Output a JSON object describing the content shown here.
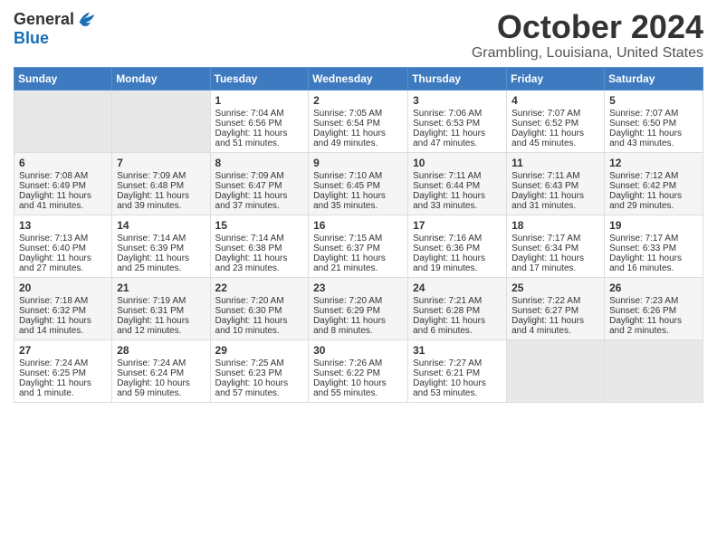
{
  "header": {
    "logo_general": "General",
    "logo_blue": "Blue",
    "month_title": "October 2024",
    "location": "Grambling, Louisiana, United States"
  },
  "days_of_week": [
    "Sunday",
    "Monday",
    "Tuesday",
    "Wednesday",
    "Thursday",
    "Friday",
    "Saturday"
  ],
  "weeks": [
    [
      {
        "day": "",
        "info": ""
      },
      {
        "day": "",
        "info": ""
      },
      {
        "day": "1",
        "info": "Sunrise: 7:04 AM\nSunset: 6:56 PM\nDaylight: 11 hours and 51 minutes."
      },
      {
        "day": "2",
        "info": "Sunrise: 7:05 AM\nSunset: 6:54 PM\nDaylight: 11 hours and 49 minutes."
      },
      {
        "day": "3",
        "info": "Sunrise: 7:06 AM\nSunset: 6:53 PM\nDaylight: 11 hours and 47 minutes."
      },
      {
        "day": "4",
        "info": "Sunrise: 7:07 AM\nSunset: 6:52 PM\nDaylight: 11 hours and 45 minutes."
      },
      {
        "day": "5",
        "info": "Sunrise: 7:07 AM\nSunset: 6:50 PM\nDaylight: 11 hours and 43 minutes."
      }
    ],
    [
      {
        "day": "6",
        "info": "Sunrise: 7:08 AM\nSunset: 6:49 PM\nDaylight: 11 hours and 41 minutes."
      },
      {
        "day": "7",
        "info": "Sunrise: 7:09 AM\nSunset: 6:48 PM\nDaylight: 11 hours and 39 minutes."
      },
      {
        "day": "8",
        "info": "Sunrise: 7:09 AM\nSunset: 6:47 PM\nDaylight: 11 hours and 37 minutes."
      },
      {
        "day": "9",
        "info": "Sunrise: 7:10 AM\nSunset: 6:45 PM\nDaylight: 11 hours and 35 minutes."
      },
      {
        "day": "10",
        "info": "Sunrise: 7:11 AM\nSunset: 6:44 PM\nDaylight: 11 hours and 33 minutes."
      },
      {
        "day": "11",
        "info": "Sunrise: 7:11 AM\nSunset: 6:43 PM\nDaylight: 11 hours and 31 minutes."
      },
      {
        "day": "12",
        "info": "Sunrise: 7:12 AM\nSunset: 6:42 PM\nDaylight: 11 hours and 29 minutes."
      }
    ],
    [
      {
        "day": "13",
        "info": "Sunrise: 7:13 AM\nSunset: 6:40 PM\nDaylight: 11 hours and 27 minutes."
      },
      {
        "day": "14",
        "info": "Sunrise: 7:14 AM\nSunset: 6:39 PM\nDaylight: 11 hours and 25 minutes."
      },
      {
        "day": "15",
        "info": "Sunrise: 7:14 AM\nSunset: 6:38 PM\nDaylight: 11 hours and 23 minutes."
      },
      {
        "day": "16",
        "info": "Sunrise: 7:15 AM\nSunset: 6:37 PM\nDaylight: 11 hours and 21 minutes."
      },
      {
        "day": "17",
        "info": "Sunrise: 7:16 AM\nSunset: 6:36 PM\nDaylight: 11 hours and 19 minutes."
      },
      {
        "day": "18",
        "info": "Sunrise: 7:17 AM\nSunset: 6:34 PM\nDaylight: 11 hours and 17 minutes."
      },
      {
        "day": "19",
        "info": "Sunrise: 7:17 AM\nSunset: 6:33 PM\nDaylight: 11 hours and 16 minutes."
      }
    ],
    [
      {
        "day": "20",
        "info": "Sunrise: 7:18 AM\nSunset: 6:32 PM\nDaylight: 11 hours and 14 minutes."
      },
      {
        "day": "21",
        "info": "Sunrise: 7:19 AM\nSunset: 6:31 PM\nDaylight: 11 hours and 12 minutes."
      },
      {
        "day": "22",
        "info": "Sunrise: 7:20 AM\nSunset: 6:30 PM\nDaylight: 11 hours and 10 minutes."
      },
      {
        "day": "23",
        "info": "Sunrise: 7:20 AM\nSunset: 6:29 PM\nDaylight: 11 hours and 8 minutes."
      },
      {
        "day": "24",
        "info": "Sunrise: 7:21 AM\nSunset: 6:28 PM\nDaylight: 11 hours and 6 minutes."
      },
      {
        "day": "25",
        "info": "Sunrise: 7:22 AM\nSunset: 6:27 PM\nDaylight: 11 hours and 4 minutes."
      },
      {
        "day": "26",
        "info": "Sunrise: 7:23 AM\nSunset: 6:26 PM\nDaylight: 11 hours and 2 minutes."
      }
    ],
    [
      {
        "day": "27",
        "info": "Sunrise: 7:24 AM\nSunset: 6:25 PM\nDaylight: 11 hours and 1 minute."
      },
      {
        "day": "28",
        "info": "Sunrise: 7:24 AM\nSunset: 6:24 PM\nDaylight: 10 hours and 59 minutes."
      },
      {
        "day": "29",
        "info": "Sunrise: 7:25 AM\nSunset: 6:23 PM\nDaylight: 10 hours and 57 minutes."
      },
      {
        "day": "30",
        "info": "Sunrise: 7:26 AM\nSunset: 6:22 PM\nDaylight: 10 hours and 55 minutes."
      },
      {
        "day": "31",
        "info": "Sunrise: 7:27 AM\nSunset: 6:21 PM\nDaylight: 10 hours and 53 minutes."
      },
      {
        "day": "",
        "info": ""
      },
      {
        "day": "",
        "info": ""
      }
    ]
  ]
}
